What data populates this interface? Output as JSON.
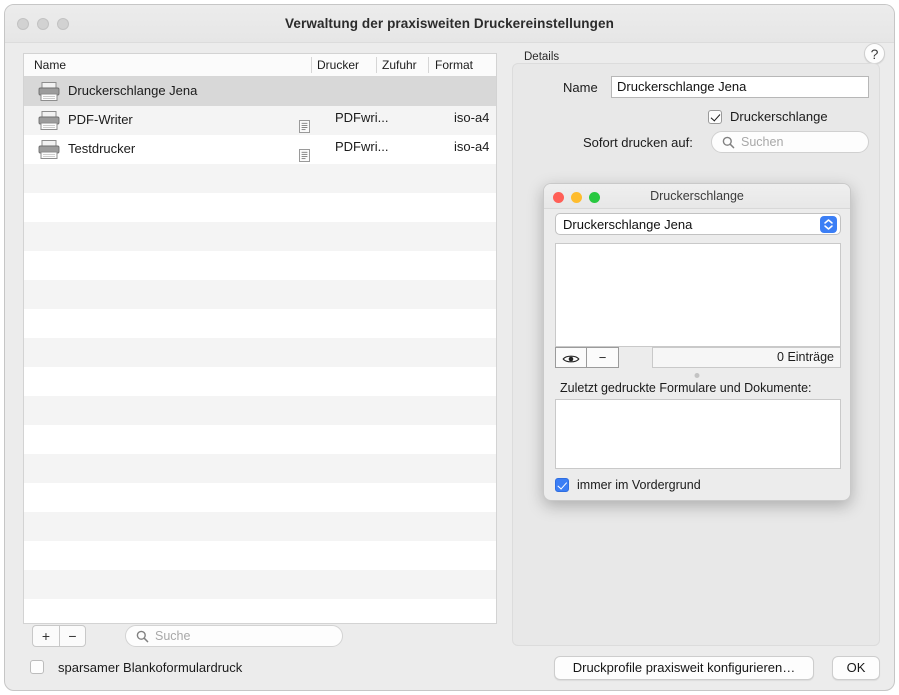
{
  "window": {
    "title": "Verwaltung der praxisweiten Druckereinstellungen",
    "traffic_lights": [
      "close",
      "minimize",
      "zoom"
    ],
    "help_label": "?"
  },
  "printer_list": {
    "columns": [
      "Name",
      "Drucker",
      "Zufuhr",
      "Format"
    ],
    "rows": [
      {
        "name": "Druckerschlange Jena",
        "drucker": "",
        "zufuhr": "",
        "format": "",
        "selected": true,
        "has_doc_icon": false
      },
      {
        "name": "PDF-Writer",
        "drucker": "PDFwri...",
        "zufuhr": "",
        "format": "iso-a4",
        "selected": false,
        "has_doc_icon": true
      },
      {
        "name": "Testdrucker",
        "drucker": "PDFwri...",
        "zufuhr": "",
        "format": "iso-a4",
        "selected": false,
        "has_doc_icon": true
      }
    ],
    "empty_row_count": 17
  },
  "list_toolbar": {
    "add_label": "+",
    "remove_label": "−",
    "search_placeholder": "Suche"
  },
  "blanko": {
    "label": "sparsamer Blankoformulardruck",
    "checked": false
  },
  "details": {
    "caption": "Details",
    "name_label": "Name",
    "name_value": "Druckerschlange Jena",
    "queue_checkbox_label": "Druckerschlange",
    "queue_checkbox_checked": true,
    "sofort_label": "Sofort drucken auf:",
    "sofort_placeholder": "Suchen",
    "sofort_value": ""
  },
  "queue_dialog": {
    "title": "Druckerschlange",
    "selected_queue": "Druckerschlange Jena",
    "queue_options": [
      "Druckerschlange Jena"
    ],
    "eye_label": "◉",
    "minus_label": "−",
    "entry_count_text": "0 Einträge",
    "recent_label": "Zuletzt gedruckte Formulare und Dokumente:",
    "foreground_label": "immer im Vordergrund",
    "foreground_checked": true
  },
  "footer": {
    "configure_label": "Druckprofile praxisweit konfigurieren…",
    "ok_label": "OK"
  },
  "colors": {
    "window_bg": "#ececec",
    "details_bg": "#e8e8e8",
    "selection": "#d8d8d8",
    "accent_blue": "#3b7ef5",
    "stripe": "#f4f4f4"
  }
}
